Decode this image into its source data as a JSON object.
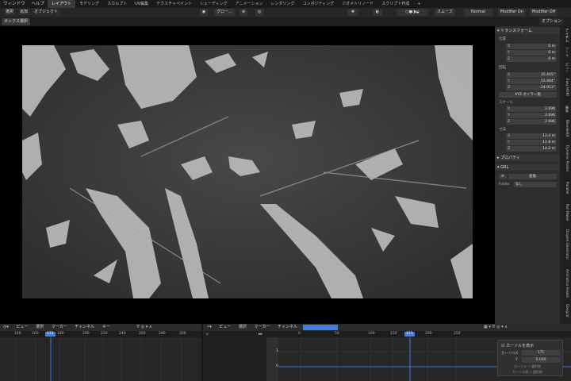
{
  "menubar": {
    "items": [
      "ウィンドウ",
      "ヘルプ"
    ],
    "workspaces": [
      {
        "label": "レイアウト",
        "active": true
      },
      {
        "label": "モデリング",
        "active": false
      },
      {
        "label": "スカルプト",
        "active": false
      },
      {
        "label": "UV編集",
        "active": false
      },
      {
        "label": "テクスチャペイント",
        "active": false
      },
      {
        "label": "シェーディング",
        "active": false
      },
      {
        "label": "アニメーション",
        "active": false
      },
      {
        "label": "レンダリング",
        "active": false
      },
      {
        "label": "コンポジティング",
        "active": false
      },
      {
        "label": "ジオメトリノード",
        "active": false
      },
      {
        "label": "スクリプト作成",
        "active": false
      }
    ],
    "add_tab": "+"
  },
  "header": {
    "menus": [
      "選択",
      "追加",
      "オブジェクト"
    ],
    "transform_orientation": "グロー...",
    "shading_mode": "スムーズ",
    "blend": "Normal",
    "modifier_on": "Modifier On",
    "modifier_off": "Modifier Off"
  },
  "subheader": {
    "box_select": "ボックス選択",
    "options": "オプション"
  },
  "npanel": {
    "transform_title": "トランスフォーム",
    "location_label": "位置",
    "location": [
      {
        "axis": "X",
        "value": "0 m"
      },
      {
        "axis": "Y",
        "value": "0 m"
      },
      {
        "axis": "Z",
        "value": "0 m"
      }
    ],
    "rotation_label": "回転",
    "rotation": [
      {
        "axis": "X",
        "value": "35.445°"
      },
      {
        "axis": "Y",
        "value": "51.484°"
      },
      {
        "axis": "Z",
        "value": "-24.913°"
      }
    ],
    "rotation_mode": "XYZ オイラー角",
    "scale_label": "スケール",
    "scale": [
      {
        "axis": "X",
        "value": "2.696"
      },
      {
        "axis": "Y",
        "value": "2.696"
      },
      {
        "axis": "Z",
        "value": "2.696"
      }
    ],
    "dims_label": "寸法",
    "dims": [
      {
        "axis": "X",
        "value": "12.4 m"
      },
      {
        "axis": "Y",
        "value": "12.8 m"
      },
      {
        "axis": "Z",
        "value": "14.2 m"
      }
    ],
    "properties_title": "プロパティ",
    "grl_title": "GRL",
    "change_btn": "変換",
    "folder_label": "Folder",
    "folder_value": "なし"
  },
  "vtabs": [
    "アイテム",
    "ツール",
    "ビュー",
    "Easy HDRI",
    "編集",
    "BlenderKit",
    "Dynamic Parent",
    "Parallel",
    "Roll Maker",
    "Droplet Generator",
    "Animation Assets",
    "Geogrid"
  ],
  "timeline_left": {
    "menus": [
      "ビュー",
      "選択",
      "マーカー",
      "チャンネル",
      "キー"
    ],
    "ticks": [
      "140",
      "160",
      "171",
      "180",
      "200",
      "220",
      "240",
      "260",
      "280",
      "300"
    ],
    "current_frame": "171"
  },
  "timeline_right": {
    "menus": [
      "ビュー",
      "選択",
      "マーカー",
      "チャンネル",
      "キー"
    ],
    "ticks": [
      "0",
      "50",
      "100",
      "150",
      "171",
      "200",
      "250"
    ],
    "current_frame": "171",
    "channel_values": [
      "1",
      "0"
    ]
  },
  "popup": {
    "title": "カーソルを表示",
    "cursor_x_label": "カーソルX",
    "cursor_x": "171",
    "cursor_y_label": "Y",
    "cursor_y": "0.000",
    "hint1": "カーソル → 選択物",
    "hint2": "カーソル値 → 選択物"
  },
  "colors": {
    "accent": "#3f7fe0",
    "panel": "#2d2d2d",
    "viewport": "#000000"
  }
}
